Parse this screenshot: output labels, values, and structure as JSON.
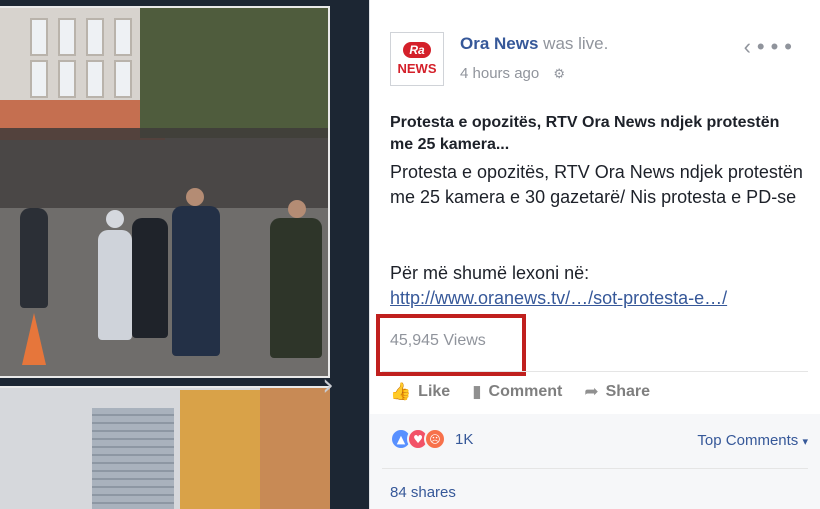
{
  "post": {
    "page_name": "Ora News",
    "status_suffix": "was live.",
    "time": "4 hours ago",
    "logo_top": "Ra",
    "logo_bottom": "NEWS",
    "title": "Protesta e opozitës, RTV Ora News ndjek protestën me 25 kamera...",
    "body": "Protesta e opozitës, RTV Ora News ndjek protestën me 25 kamera e 30 gazetarë/ Nis protesta e PD-se",
    "more_text": "Për më shumë lexoni në:",
    "link": "http://www.oranews.tv/…/sot-protesta-e…/",
    "views": "45,945 Views"
  },
  "actions": {
    "like": "Like",
    "comment": "Comment",
    "share": "Share"
  },
  "reactions": {
    "count": "1K",
    "top_comments": "Top Comments",
    "shares": "84 shares"
  },
  "icons": {
    "back": "chevron-left-icon",
    "more": "more-dots-icon",
    "privacy": "globe-icon",
    "like": "thumbs-up-icon",
    "comment": "comment-icon",
    "share": "share-arrow-icon"
  },
  "colors": {
    "link": "#365899",
    "highlight_box": "#c0201e",
    "brand_red": "#d4202a"
  }
}
